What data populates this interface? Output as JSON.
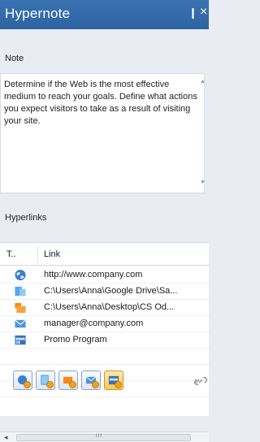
{
  "panel": {
    "title": "Hypernote",
    "pin_glyph": "❙",
    "close_glyph": "×"
  },
  "note": {
    "label": "Note",
    "text": "Determine if the Web is the most effective medium to reach your goals. Define what actions you expect visitors to take as a result of visiting your site."
  },
  "hyperlinks": {
    "label": "Hyperlinks",
    "columns": {
      "type": "T..",
      "link": "Link"
    },
    "rows": [
      {
        "icon": "globe-icon",
        "text": "http://www.company.com"
      },
      {
        "icon": "file-icon",
        "text": "C:\\Users\\Anna\\Google Drive\\Sa..."
      },
      {
        "icon": "folder-icon",
        "text": "C:\\Users\\Anna\\Desktop\\CS Od..."
      },
      {
        "icon": "mail-icon",
        "text": "manager@company.com"
      },
      {
        "icon": "program-icon",
        "text": "Promo Program"
      }
    ]
  },
  "toolbar": {
    "buttons": [
      {
        "icon": "add-url-icon"
      },
      {
        "icon": "add-file-icon"
      },
      {
        "icon": "add-folder-icon"
      },
      {
        "icon": "add-email-icon"
      },
      {
        "icon": "add-program-icon"
      }
    ],
    "extra_icon": "link-chain-icon"
  },
  "scrollbar": {
    "left_arrow": "◂",
    "grip": "III"
  },
  "colors": {
    "titlebar": "#2e63a2",
    "accent": "#f4a21a",
    "panel_bg": "#e9edf3"
  }
}
